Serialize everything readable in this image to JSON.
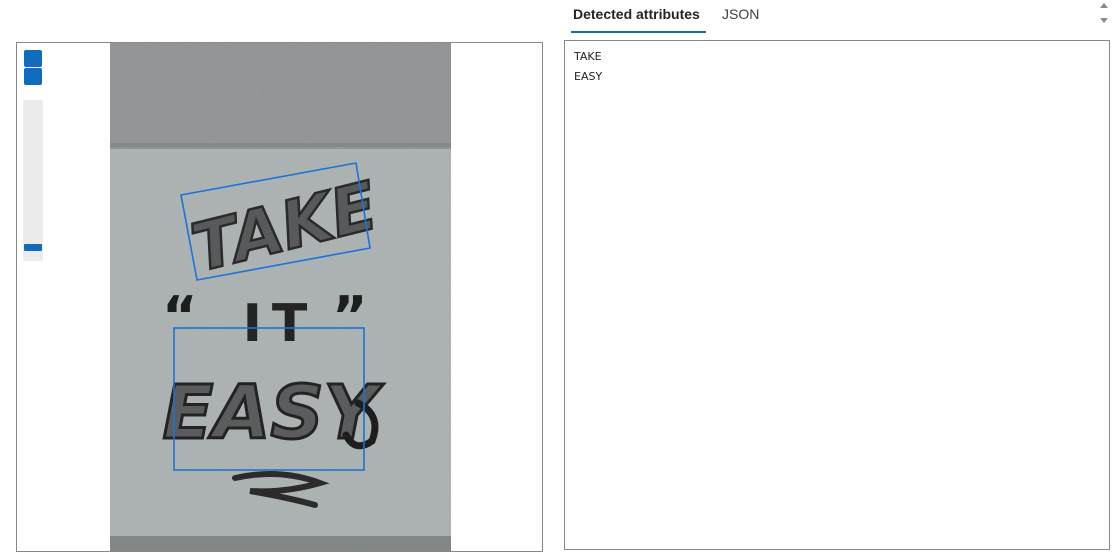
{
  "tabs": [
    {
      "label": "Detected attributes",
      "active": true
    },
    {
      "label": "JSON",
      "active": false
    }
  ],
  "viewer": {
    "zoom_level_fraction": 0.95,
    "graffiti_words": [
      "TAKE",
      "IT",
      "EASY"
    ]
  },
  "detected_lines": [
    {
      "text": "TAKE"
    },
    {
      "text": "EASY"
    }
  ],
  "colors": {
    "accent": "#0f6cbd",
    "bounding_box": "#1a73d9",
    "border": "#8a8886"
  },
  "icons": [
    "zoom-in-icon",
    "zoom-out-icon",
    "scroll-up-icon",
    "scroll-down-icon"
  ]
}
